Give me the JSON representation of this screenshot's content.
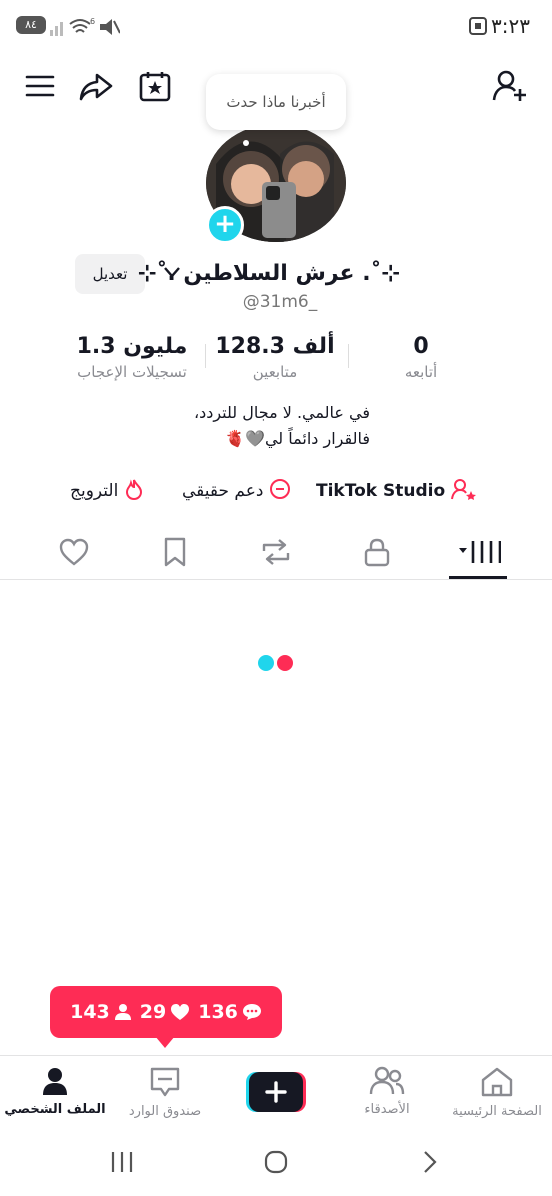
{
  "status": {
    "battery": "٨٤",
    "time": "٣:٢٣"
  },
  "profile": {
    "thought_bubble": "أخبرنا ماذا حدث",
    "edit_label": "تعديل",
    "name": "⊹˚. عرش السلاطين .˚⊹",
    "username": "@31m6_"
  },
  "stats": [
    {
      "value": "1.3 مليون",
      "label": "تسجيلات الإعجاب"
    },
    {
      "value": "128.3 ألف",
      "label": "متابعين"
    },
    {
      "value": "0",
      "label": "أتابعه"
    }
  ],
  "bio": {
    "line1": "في عالمي. لا مجال للتردد،",
    "line2": "فالقرار دائماً لي🩶🫀"
  },
  "links": {
    "promote": "الترويج",
    "support": "دعم حقيقي",
    "studio": "TikTok Studio"
  },
  "notification": {
    "comments": "136",
    "likes": "29",
    "followers": "143"
  },
  "nav": {
    "home": "الصفحة الرئيسية",
    "friends": "الأصدقاء",
    "inbox": "صندوق الوارد",
    "profile": "الملف الشخصي"
  },
  "colors": {
    "accent": "#fe2c55",
    "cyan": "#20d5ec"
  }
}
